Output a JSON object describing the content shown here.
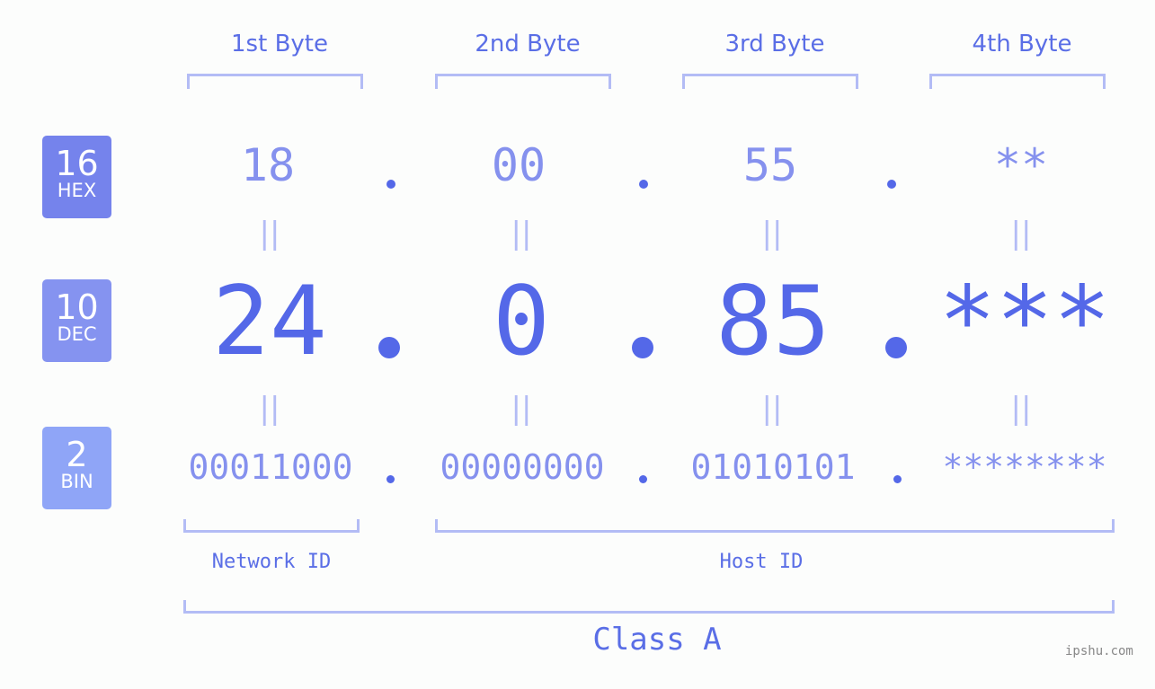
{
  "byte_headers": [
    "1st Byte",
    "2nd Byte",
    "3rd Byte",
    "4th Byte"
  ],
  "badges": {
    "hex": {
      "num": "16",
      "label": "HEX",
      "color": "#7583ec"
    },
    "dec": {
      "num": "10",
      "label": "DEC",
      "color": "#8593f0"
    },
    "bin": {
      "num": "2",
      "label": "BIN",
      "color": "#8fa5f7"
    }
  },
  "hex_values": [
    "18",
    "00",
    "55",
    "**"
  ],
  "dec_values": [
    "24",
    "0",
    "85",
    "***"
  ],
  "bin_values": [
    "00011000",
    "00000000",
    "01010101",
    "********"
  ],
  "equals_sign": "||",
  "network_id_label": "Network ID",
  "host_id_label": "Host ID",
  "class_label": "Class A",
  "watermark": "ipshu.com",
  "colors": {
    "accent": "#5468e8",
    "light": "#8591ee",
    "bracket": "#b3bcf5"
  }
}
